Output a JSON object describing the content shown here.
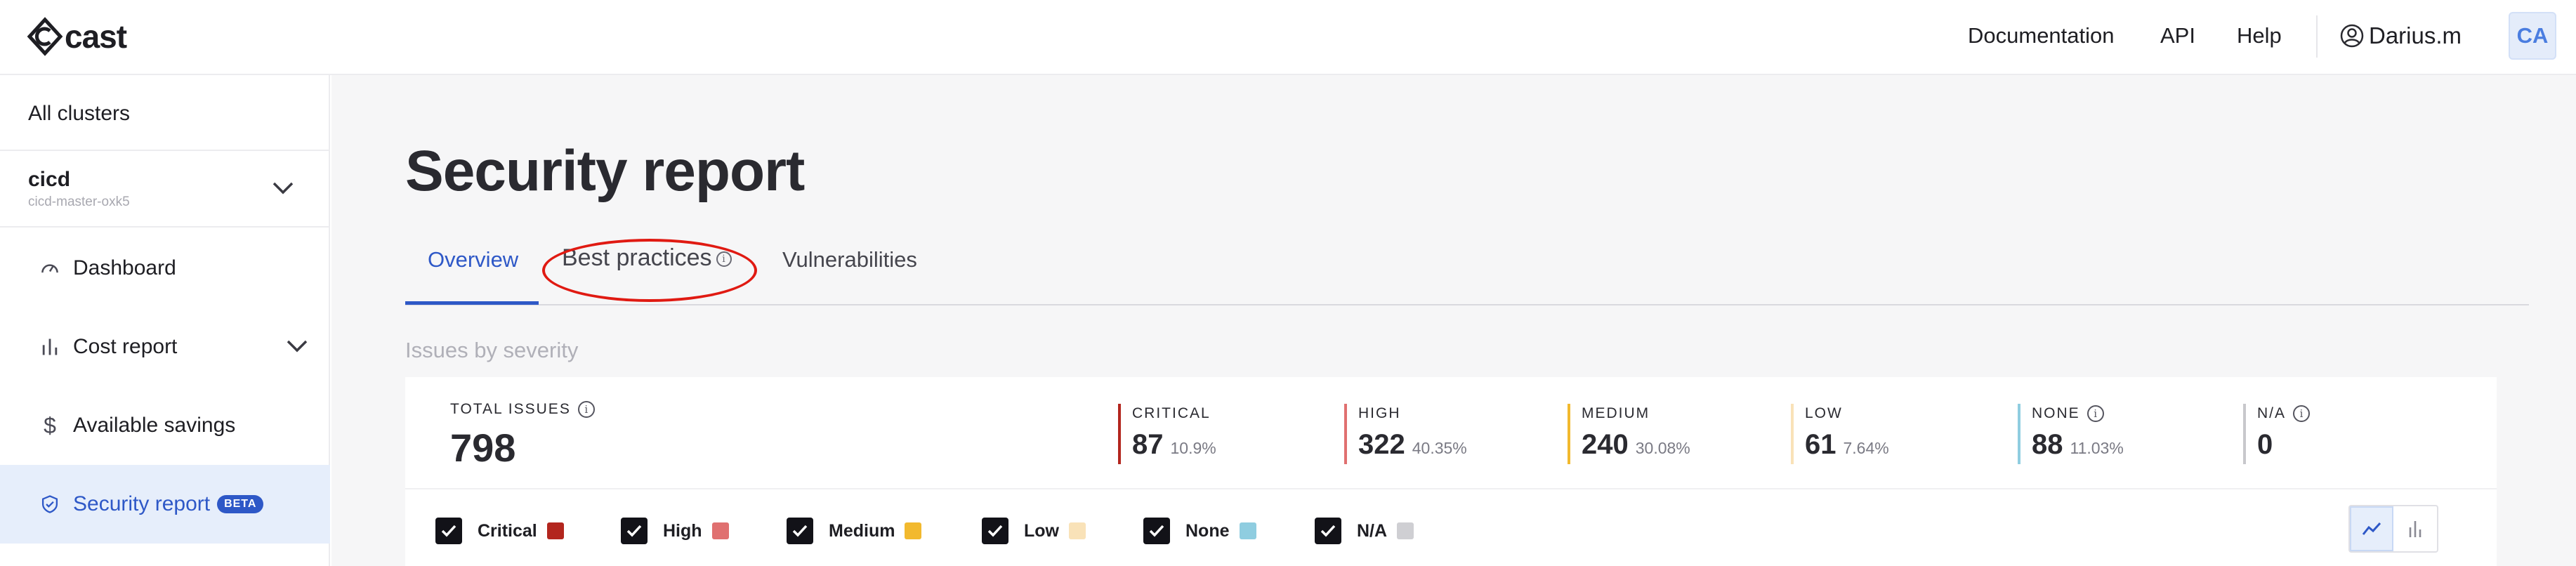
{
  "app": {
    "logo_text": "cast",
    "user_initials": "CA"
  },
  "topnav": {
    "documentation": "Documentation",
    "api": "API",
    "help": "Help",
    "user_name": "Darius.m"
  },
  "sidebar": {
    "all_clusters": "All clusters",
    "cluster_name": "cicd",
    "cluster_id": "cicd-master-oxk5",
    "items": [
      {
        "label": "Dashboard",
        "icon": "gauge-icon"
      },
      {
        "label": "Cost report",
        "icon": "bar-chart-icon"
      },
      {
        "label": "Available savings",
        "icon": "dollar-icon"
      },
      {
        "label": "Security report",
        "icon": "shield-icon",
        "badge": "BETA",
        "active": true
      }
    ]
  },
  "page": {
    "title": "Security report",
    "tabs": [
      "Overview",
      "Best practices",
      "Vulnerabilities"
    ],
    "active_tab": "Overview",
    "section_title": "Issues by severity"
  },
  "issues": {
    "total_label": "TOTAL ISSUES",
    "total_value": "798",
    "severities": [
      {
        "label": "CRITICAL",
        "value": "87",
        "percent": "10.9%",
        "color": "#b3261e"
      },
      {
        "label": "HIGH",
        "value": "322",
        "percent": "40.35%",
        "color": "#e07070"
      },
      {
        "label": "MEDIUM",
        "value": "240",
        "percent": "30.08%",
        "color": "#f2b92e"
      },
      {
        "label": "LOW",
        "value": "61",
        "percent": "7.64%",
        "color": "#f9e2b8"
      },
      {
        "label": "NONE",
        "value": "88",
        "percent": "11.03%",
        "color": "#8fcde0"
      },
      {
        "label": "N/A",
        "value": "0",
        "percent": "",
        "color": "#c8c8cc"
      }
    ]
  },
  "filters": [
    {
      "label": "Critical",
      "checked": true,
      "color": "#b3261e"
    },
    {
      "label": "High",
      "checked": true,
      "color": "#e07070"
    },
    {
      "label": "Medium",
      "checked": true,
      "color": "#f2b92e"
    },
    {
      "label": "Low",
      "checked": true,
      "color": "#f9e2b8"
    },
    {
      "label": "None",
      "checked": true,
      "color": "#8fcde0"
    },
    {
      "label": "N/A",
      "checked": true,
      "color": "#cfcfd3"
    }
  ],
  "colors": {
    "accent": "#2e58c7",
    "highlight_ring": "#e01a12"
  }
}
